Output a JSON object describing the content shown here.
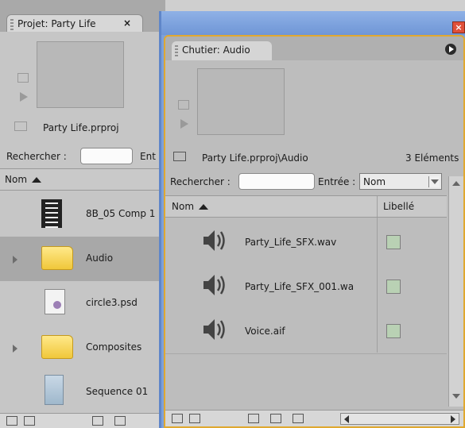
{
  "project_panel": {
    "tab_label": "Projet: Party Life",
    "tab_close": "×",
    "file_name": "Party Life.prproj",
    "search_label": "Rechercher :",
    "entry_label_partial": "Ent",
    "column_name": "Nom",
    "items": [
      {
        "name": "8B_05 Comp 1",
        "icon": "film-strip-icon",
        "expandable": false,
        "selected": false
      },
      {
        "name": "Audio",
        "icon": "folder-icon",
        "expandable": true,
        "selected": true
      },
      {
        "name": "circle3.psd",
        "icon": "psd-file-icon",
        "expandable": false,
        "selected": false
      },
      {
        "name": "Composites",
        "icon": "folder-icon",
        "expandable": true,
        "selected": false
      },
      {
        "name": "Sequence 01",
        "icon": "sequence-icon",
        "expandable": false,
        "selected": false
      }
    ]
  },
  "bin_panel": {
    "close_glyph": "×",
    "tab_label": "Chutier: Audio",
    "path": "Party Life.prproj\\Audio",
    "count": "3 Eléments",
    "search_label": "Rechercher :",
    "entry_label": "Entrée :",
    "entry_value": "Nom",
    "col_name": "Nom",
    "col_label": "Libellé",
    "items": [
      {
        "name": "Party_Life_SFX.wav",
        "icon": "speaker-icon",
        "label_color": "#b9d1b4"
      },
      {
        "name": "Party_Life_SFX_001.wa",
        "icon": "speaker-icon",
        "label_color": "#b9d1b4"
      },
      {
        "name": "Voice.aif",
        "icon": "speaker-icon",
        "label_color": "#b9d1b4"
      }
    ]
  },
  "colors": {
    "window_title_blue": "#7da0d9",
    "panel_focus_orange": "#e0a830",
    "selected_row": "#a8a8a8"
  }
}
